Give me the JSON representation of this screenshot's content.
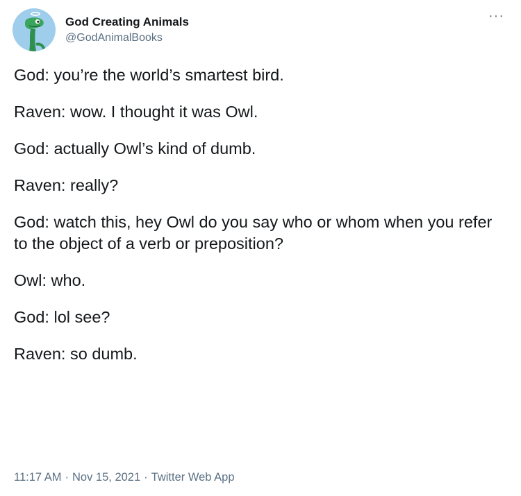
{
  "account": {
    "display_name": "God Creating Animals",
    "handle": "@GodAnimalBooks",
    "avatar_icon": "green-dinosaur-avatar-icon",
    "avatar_bg": "#9fcdec"
  },
  "more_menu_icon": "ellipsis-icon",
  "tweet_lines": [
    "God: you’re the world’s smartest bird.",
    "Raven: wow. I thought it was Owl.",
    "God: actually Owl’s kind of dumb.",
    "Raven: really?",
    "God: watch this, hey Owl do you say who or whom when you refer to the object of a verb or preposition?",
    "Owl: who.",
    "God: lol see?",
    "Raven: so dumb."
  ],
  "meta": {
    "time": "11:17 AM",
    "date": "Nov 15, 2021",
    "source": "Twitter Web App",
    "separator": "·"
  },
  "colors": {
    "text": "#14171a",
    "secondary": "#5b7083"
  }
}
